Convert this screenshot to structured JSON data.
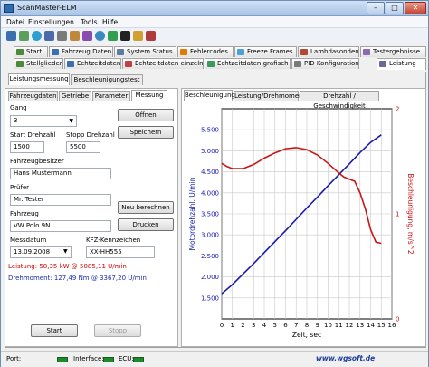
{
  "window": {
    "title": "ScanMaster-ELM"
  },
  "menu": {
    "items": [
      "Datei",
      "Einstellungen",
      "Tools",
      "Hilfe"
    ]
  },
  "tabs_row1": [
    {
      "label": "Start",
      "icon": "home-icon",
      "color": "#4a8a3a"
    },
    {
      "label": "Fahrzeug Daten",
      "icon": "car-icon",
      "color": "#3a6fb0"
    },
    {
      "label": "System Status",
      "icon": "monitor-icon",
      "color": "#5d7aa0"
    },
    {
      "label": "Fehlercodes",
      "icon": "warning-icon",
      "color": "#e07a00"
    },
    {
      "label": "Freeze Frames",
      "icon": "snowflake-icon",
      "color": "#4aa0d8"
    },
    {
      "label": "Lambdasonden",
      "icon": "sensor-icon",
      "color": "#b04a30"
    },
    {
      "label": "Testergebnisse",
      "icon": "checklist-icon",
      "color": "#8a6ab0"
    }
  ],
  "tabs_row2": [
    {
      "label": "Stellglieder",
      "icon": "actuator-icon",
      "color": "#4a8a3a"
    },
    {
      "label": "Echtzeitdaten",
      "icon": "realtime-icon",
      "color": "#3a6fb0"
    },
    {
      "label": "Echtzeitdaten einzeln",
      "icon": "gauge-icon",
      "color": "#c04040"
    },
    {
      "label": "Echtzeitdaten grafisch",
      "icon": "graph-icon",
      "color": "#3a9a5a"
    },
    {
      "label": "PID Konfiguration",
      "icon": "config-icon",
      "color": "#7a7a7a"
    },
    {
      "label": "Leistung",
      "icon": "power-icon",
      "color": "#6a6a9a"
    }
  ],
  "subtabs": [
    "Leistungsmessung",
    "Beschleunigungstest"
  ],
  "left_tabs": [
    "Fahrzeugdaten",
    "Getriebe",
    "Parameter",
    "Messung"
  ],
  "form": {
    "gang_label": "Gang",
    "gang_value": "3",
    "start_rpm_label": "Start Drehzahl",
    "start_rpm_value": "1500",
    "stop_rpm_label": "Stopp Drehzahl",
    "stop_rpm_value": "5500",
    "owner_label": "Fahrzeugbesitzer",
    "owner_value": "Hans Mustermann",
    "tester_label": "Prüfer",
    "tester_value": "Mr. Tester",
    "vehicle_label": "Fahrzeug",
    "vehicle_value": "VW Polo 9N",
    "date_label": "Messdatum",
    "date_value": "13.09.2008",
    "plate_label": "KFZ-Kennzeichen",
    "plate_value": "XX-HH555",
    "result_power": "Leistung: 58,35 kW @ 5085,11 U/min",
    "result_torque": "Drehmoment: 127,49 Nm @ 3367,20 U/min"
  },
  "buttons": {
    "open": "Öffnen",
    "save": "Speichern",
    "recalc": "Neu berechnen",
    "print": "Drucken",
    "start": "Start",
    "stop": "Stopp"
  },
  "chart_tabs": [
    "Beschleunigung",
    "Leistung/Drehmoment",
    "Drehzahl / Geschwindigkeit"
  ],
  "chart_data": {
    "type": "line",
    "title": "",
    "xlabel": "Zeit, sec",
    "ylabel": "Motordrehzahl, U/min",
    "y2label": "Beschleunigung, m/s^2",
    "xlim": [
      0,
      16
    ],
    "ylim": [
      1000,
      6000
    ],
    "y2lim": [
      0,
      2
    ],
    "x_ticks": [
      0,
      1,
      2,
      3,
      4,
      5,
      6,
      7,
      8,
      9,
      10,
      11,
      12,
      13,
      14,
      15,
      16
    ],
    "y_ticks": [
      {
        "value": 1500,
        "label": "1.500"
      },
      {
        "value": 2000,
        "label": "2.000"
      },
      {
        "value": 2500,
        "label": "2.500"
      },
      {
        "value": 3000,
        "label": "3.000"
      },
      {
        "value": 3500,
        "label": "3.500"
      },
      {
        "value": 4000,
        "label": "4.000"
      },
      {
        "value": 4500,
        "label": "4.500"
      },
      {
        "value": 5000,
        "label": "5.000"
      },
      {
        "value": 5500,
        "label": "5.500"
      }
    ],
    "y2_ticks": [
      {
        "value": 0,
        "label": "0"
      },
      {
        "value": 1,
        "label": "1"
      },
      {
        "value": 2,
        "label": "2"
      }
    ],
    "grid": true,
    "series": [
      {
        "axis": "left",
        "color": "#1a1ab0",
        "x": [
          0,
          1,
          2,
          3,
          4,
          5,
          6,
          7,
          8,
          9,
          10,
          11,
          12,
          13,
          14,
          15
        ],
        "y": [
          1600,
          1820,
          2070,
          2320,
          2580,
          2840,
          3100,
          3370,
          3640,
          3900,
          4170,
          4430,
          4690,
          4960,
          5200,
          5380
        ]
      },
      {
        "axis": "right",
        "color": "#c81414",
        "x": [
          0,
          0.5,
          1,
          1.5,
          2,
          3,
          4,
          5,
          6,
          7,
          8,
          9,
          10,
          11,
          11.5,
          12,
          12.5,
          13,
          13.5,
          14,
          14.5,
          15
        ],
        "y": [
          1.48,
          1.45,
          1.43,
          1.43,
          1.43,
          1.47,
          1.53,
          1.58,
          1.62,
          1.63,
          1.61,
          1.56,
          1.48,
          1.39,
          1.35,
          1.33,
          1.31,
          1.2,
          1.05,
          0.85,
          0.73,
          0.72
        ]
      }
    ]
  },
  "status": {
    "port_label": "Port:",
    "interface_label": "Interface:",
    "ecu_label": "ECU:",
    "website": "www.wgsoft.de"
  },
  "colors": {
    "title_gradient_top": "#cfe0f5",
    "rpm_line": "#1a1ab0",
    "accel_line": "#c81414",
    "led_green": "#1f8a2d",
    "power_text": "#d20000",
    "torque_text": "#1a2ab0"
  }
}
